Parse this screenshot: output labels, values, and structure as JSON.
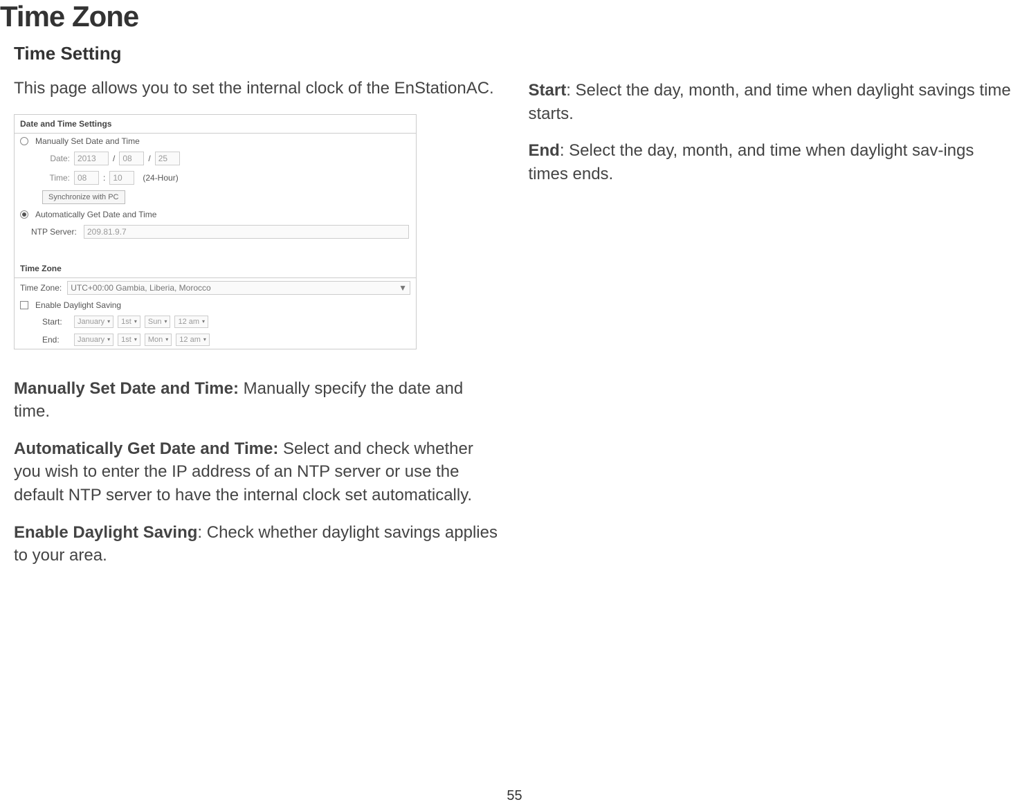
{
  "title": "Time Zone",
  "left": {
    "heading": "Time Setting",
    "intro": "This page allows you to set the internal clock of the EnStationAC.",
    "panel": {
      "header1": "Date and Time Settings",
      "manual_radio_label": "Manually Set Date and Time",
      "date_label": "Date:",
      "date_year": "2013",
      "date_month": "08",
      "date_day": "25",
      "time_label": "Time:",
      "time_hour": "08",
      "time_min": "10",
      "time_suffix": "(24-Hour)",
      "sync_btn": "Synchronize with PC",
      "auto_radio_label": "Automatically Get Date and Time",
      "ntp_label": "NTP Server:",
      "ntp_value": "209.81.9.7",
      "header2": "Time Zone",
      "tz_label": "Time Zone:",
      "tz_value": "UTC+00:00 Gambia, Liberia, Morocco",
      "dst_label": "Enable Daylight Saving",
      "start_label": "Start:",
      "start_month": "January",
      "start_week": "1st",
      "start_day": "Sun",
      "start_time": "12 am",
      "end_label": "End:",
      "end_month": "January",
      "end_week": "1st",
      "end_day": "Mon",
      "end_time": "12 am"
    },
    "p_manual_label": "Manually Set Date and Time:",
    "p_manual_text": " Manually specify the date and time.",
    "p_auto_label": "Automatically Get Date and Time:",
    "p_auto_text": " Select and check whether you wish to enter the IP address of an NTP server or use the default NTP server to have the internal clock set automatically.",
    "p_dst_label": "Enable Daylight Saving",
    "p_dst_text": ": Check whether daylight savings applies to your area."
  },
  "right": {
    "p_start_label": "Start",
    "p_start_text": ": Select the day, month, and time when daylight savings time starts.",
    "p_end_label": "End",
    "p_end_text": ": Select the day, month, and time when daylight sav-ings times ends."
  },
  "page_number": "55"
}
